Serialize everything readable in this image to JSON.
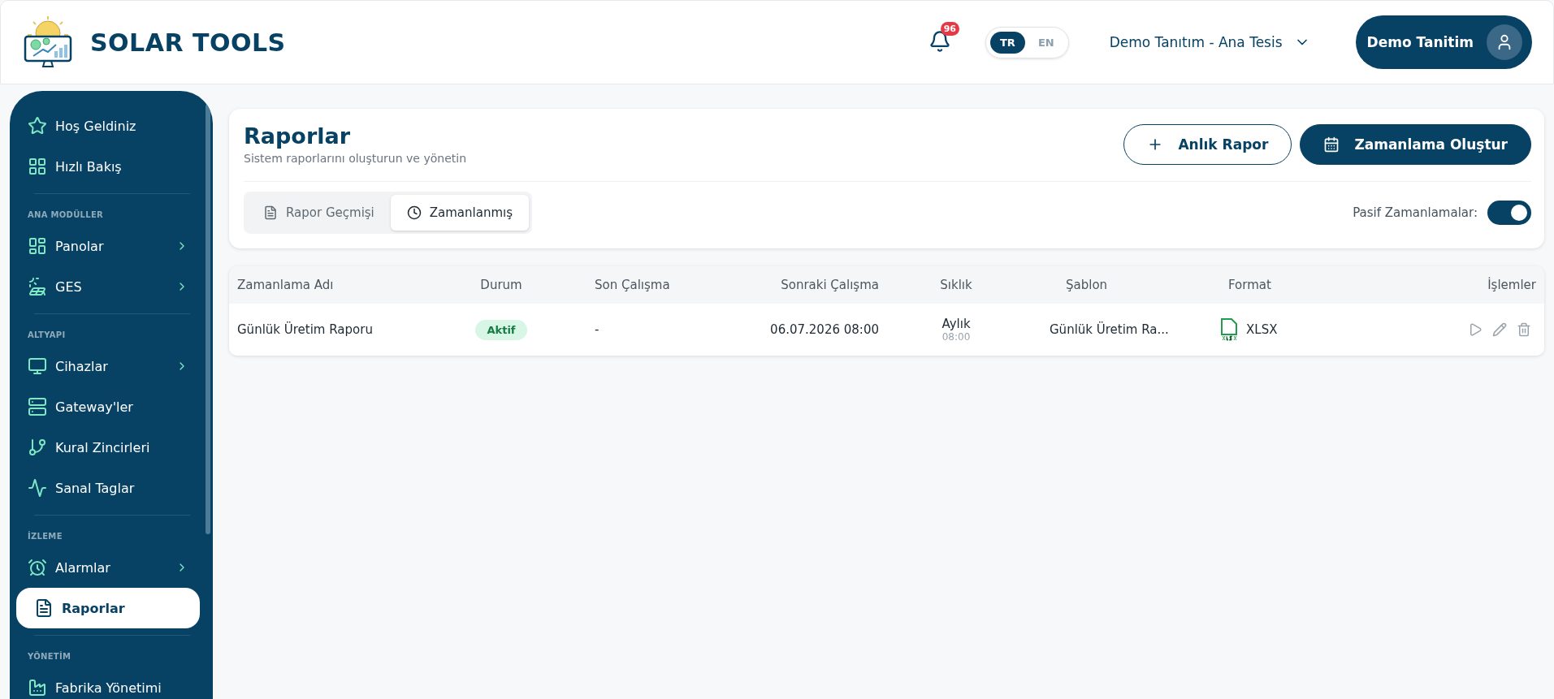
{
  "header": {
    "brand": "SOLAR TOOLS",
    "notifications": "96",
    "languages": [
      {
        "label": "TR",
        "selected": true
      },
      {
        "label": "EN",
        "selected": false
      }
    ],
    "facility": "Demo Tanıtım - Ana Tesis",
    "user": "Demo Tanitim"
  },
  "sidebar": {
    "sections": [
      {
        "items": [
          {
            "label": "Hoş Geldiniz",
            "has_submenu": false,
            "selected": false
          },
          {
            "label": "Hızlı Bakış",
            "has_submenu": false,
            "selected": false
          }
        ]
      },
      {
        "title": "ANA MODÜLLER",
        "items": [
          {
            "label": "Panolar",
            "has_submenu": true,
            "selected": false
          },
          {
            "label": "GES",
            "has_submenu": true,
            "selected": false
          }
        ]
      },
      {
        "title": "ALTYAPI",
        "items": [
          {
            "label": "Cihazlar",
            "has_submenu": true,
            "selected": false
          },
          {
            "label": "Gateway'ler",
            "has_submenu": false,
            "selected": false
          },
          {
            "label": "Kural Zincirleri",
            "has_submenu": false,
            "selected": false
          },
          {
            "label": "Sanal Taglar",
            "has_submenu": false,
            "selected": false
          }
        ]
      },
      {
        "title": "İZLEME",
        "items": [
          {
            "label": "Alarmlar",
            "has_submenu": true,
            "selected": false
          },
          {
            "label": "Raporlar",
            "has_submenu": false,
            "selected": true
          }
        ]
      },
      {
        "title": "YÖNETİM",
        "items": [
          {
            "label": "Fabrika Yönetimi",
            "has_submenu": false,
            "selected": false
          }
        ]
      }
    ]
  },
  "page": {
    "title": "Raporlar",
    "subtitle": "Sistem raporlarını oluşturun ve yönetin",
    "buttons": [
      {
        "label": "Anlık Rapor",
        "kind": "outline"
      },
      {
        "label": "Zamanlama Oluştur",
        "kind": "primary"
      }
    ],
    "tabs": [
      {
        "label": "Rapor Geçmişi",
        "selected": false
      },
      {
        "label": "Zamanlanmış",
        "selected": true
      }
    ],
    "inactive_toggle": {
      "label": "Pasif Zamanlamalar:",
      "on": true
    }
  },
  "table": {
    "columns": [
      "Zamanlama Adı",
      "Durum",
      "Son Çalışma",
      "Sonraki Çalışma",
      "Sıklık",
      "Şablon",
      "Format",
      "İşlemler"
    ],
    "rows": [
      {
        "name": "Günlük Üretim Raporu",
        "status": "Aktif",
        "kind": "active",
        "last_run": "-",
        "next_run": "06.07.2026 08:00",
        "frequency": "Aylık",
        "time": "08:00",
        "template": "Günlük Üretim Ra...",
        "format": "XLSX"
      }
    ]
  }
}
